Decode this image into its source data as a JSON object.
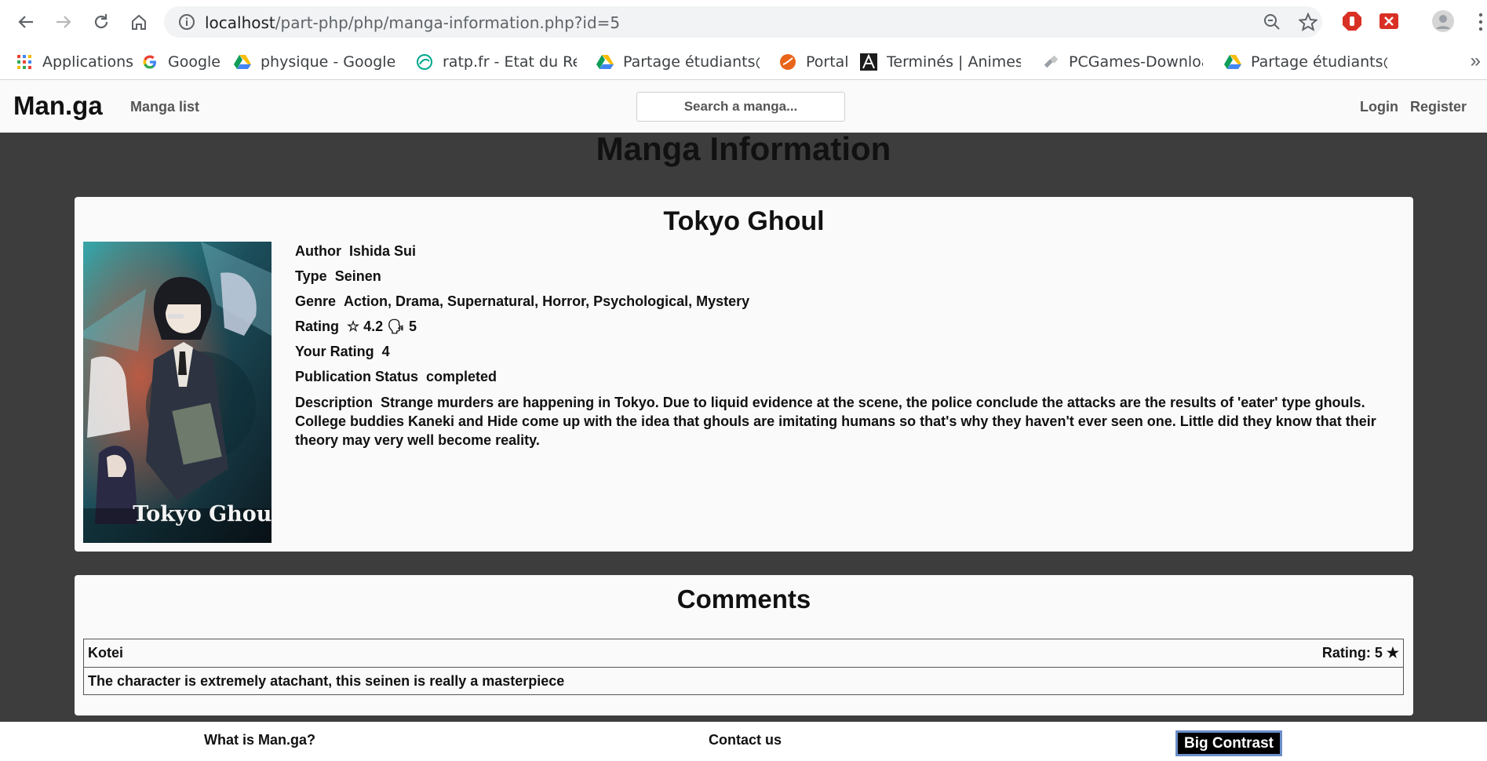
{
  "browser": {
    "url_host": "localhost",
    "url_path": "/part-php/php/manga-information.php?id=5",
    "bookmarks": [
      {
        "label": "Applications",
        "icon": "apps-grid-icon"
      },
      {
        "label": "Google",
        "icon": "google-icon"
      },
      {
        "label": "physique - Google D",
        "icon": "google-drive-icon"
      },
      {
        "label": "ratp.fr - Etat du Résea",
        "icon": "ratp-icon"
      },
      {
        "label": "Partage étudiants@E",
        "icon": "google-drive-icon"
      },
      {
        "label": "Portal",
        "icon": "portal-icon"
      },
      {
        "label": "Terminés | Animes-M",
        "icon": "animes-icon"
      },
      {
        "label": "PCGames-Download",
        "icon": "pcgames-icon"
      },
      {
        "label": "Partage étudiants@E",
        "icon": "google-drive-icon"
      }
    ],
    "more": "»"
  },
  "header": {
    "logo": "Man.ga",
    "nav_manga_list": "Manga list",
    "search_placeholder": "Search a manga...",
    "login": "Login",
    "register": "Register"
  },
  "page": {
    "title": "Manga Information"
  },
  "manga": {
    "title": "Tokyo Ghoul",
    "cover_text": "Tokyo Ghoul",
    "author_label": "Author",
    "author": "Ishida Sui",
    "type_label": "Type",
    "type": "Seinen",
    "genre_label": "Genre",
    "genre": "Action, Drama, Supernatural, Horror, Psychological, Mystery",
    "rating_label": "Rating",
    "rating_value": "☆ 4.2 🗣 5",
    "your_rating_label": "Your Rating",
    "your_rating": "4",
    "status_label": "Publication Status",
    "status": "completed",
    "description_label": "Description",
    "description": "Strange murders are happening in Tokyo. Due to liquid evidence at the scene, the police conclude the attacks are the results of 'eater' type ghouls. College buddies Kaneki and Hide come up with the idea that ghouls are imitating humans so that's why they haven't ever seen one. Little did they know that their theory may very well become reality."
  },
  "comments": {
    "title": "Comments",
    "items": [
      {
        "user": "Kotei",
        "rating": "Rating: 5 ★",
        "text": "The character is extremely atachant, this seinen is really a masterpiece"
      }
    ]
  },
  "footer": {
    "what_is": "What is Man.ga?",
    "contact": "Contact us",
    "contrast": "Big Contrast"
  }
}
